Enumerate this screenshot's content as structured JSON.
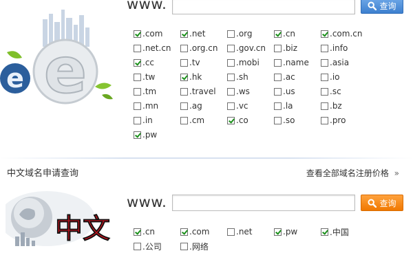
{
  "top": {
    "www": "www.",
    "search_value": "",
    "button_label": "查询",
    "extensions": [
      {
        "label": ".com",
        "checked": true
      },
      {
        "label": ".net",
        "checked": true
      },
      {
        "label": ".org",
        "checked": false
      },
      {
        "label": ".cn",
        "checked": true
      },
      {
        "label": ".com.cn",
        "checked": true
      },
      {
        "label": ".net.cn",
        "checked": false
      },
      {
        "label": ".org.cn",
        "checked": false
      },
      {
        "label": ".gov.cn",
        "checked": false
      },
      {
        "label": ".biz",
        "checked": false
      },
      {
        "label": ".info",
        "checked": false
      },
      {
        "label": ".cc",
        "checked": true
      },
      {
        "label": ".tv",
        "checked": false
      },
      {
        "label": ".mobi",
        "checked": false
      },
      {
        "label": ".name",
        "checked": false
      },
      {
        "label": ".asia",
        "checked": false
      },
      {
        "label": ".tw",
        "checked": false
      },
      {
        "label": ".hk",
        "checked": true
      },
      {
        "label": ".sh",
        "checked": false
      },
      {
        "label": ".ac",
        "checked": false
      },
      {
        "label": ".io",
        "checked": false
      },
      {
        "label": ".tm",
        "checked": false
      },
      {
        "label": ".travel",
        "checked": false
      },
      {
        "label": ".ws",
        "checked": false
      },
      {
        "label": ".us",
        "checked": false
      },
      {
        "label": ".sc",
        "checked": false
      },
      {
        "label": ".mn",
        "checked": false
      },
      {
        "label": ".ag",
        "checked": false
      },
      {
        "label": ".vc",
        "checked": false
      },
      {
        "label": ".la",
        "checked": false
      },
      {
        "label": ".bz",
        "checked": false
      },
      {
        "label": ".in",
        "checked": false
      },
      {
        "label": ".cm",
        "checked": false
      },
      {
        "label": ".co",
        "checked": true
      },
      {
        "label": ".so",
        "checked": false
      },
      {
        "label": ".pro",
        "checked": false
      },
      {
        "label": ".pw",
        "checked": true
      }
    ]
  },
  "chinese": {
    "section_title": "中文域名申请查询",
    "price_link": "查看全部域名注册价格",
    "price_link_arrow": "»",
    "www": "www.",
    "search_value": "",
    "button_label": "查询",
    "art_text": "中文",
    "extensions": [
      {
        "label": ".cn",
        "checked": true
      },
      {
        "label": ".com",
        "checked": true
      },
      {
        "label": ".net",
        "checked": false
      },
      {
        "label": ".pw",
        "checked": true
      },
      {
        "label": ".中国",
        "checked": true
      },
      {
        "label": ".公司",
        "checked": false
      },
      {
        "label": ".网络",
        "checked": false
      }
    ]
  },
  "colors": {
    "check": "#1a8f1a",
    "button_blue": "#3d7fcf",
    "button_orange": "#f07800",
    "art_red": "#c8141e"
  },
  "icons": {
    "search": "magnifier-icon"
  }
}
